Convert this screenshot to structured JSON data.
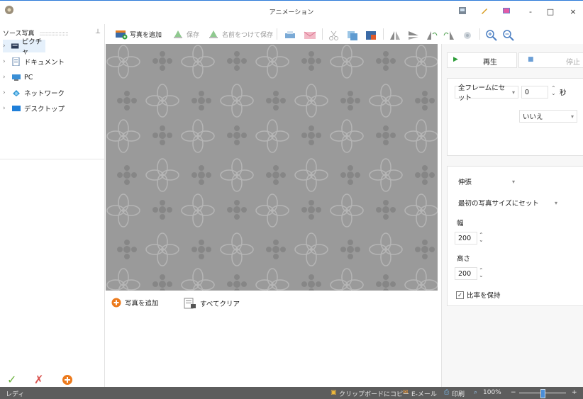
{
  "window": {
    "title": "アニメーション",
    "controls": [
      "-",
      "□",
      "×"
    ]
  },
  "left_panel": {
    "header": "ソース写真",
    "pin_glyph": "ꟷ",
    "tree": [
      {
        "label": "ピクチャ",
        "icon": "pictures-folder-icon"
      },
      {
        "label": "ドキュメント",
        "icon": "documents-folder-icon"
      },
      {
        "label": "PC",
        "icon": "computer-icon"
      },
      {
        "label": "ネットワーク",
        "icon": "network-icon"
      },
      {
        "label": "デスクトップ",
        "icon": "desktop-icon"
      }
    ],
    "bottom_icons": [
      "check-icon",
      "cross-icon",
      "add-circle-icon"
    ]
  },
  "toolbar": {
    "add_photo": "写真を追加",
    "save": "保存",
    "save_as": "名前をつけて保存"
  },
  "thumb_bar": {
    "add_photo": "写真を追加",
    "clear_all": "すべてクリア"
  },
  "right_panel": {
    "play": "再生",
    "stop": "停止",
    "frame_mode": "全フレームにセット",
    "seconds_value": "0",
    "seconds_unit": "秒",
    "loop": "いいえ",
    "resize_mode": "伸張",
    "size_mode": "最初の写真サイズにセット",
    "width_label": "幅",
    "width_value": "200",
    "height_label": "高さ",
    "height_value": "200",
    "keep_ratio": "比率を保持"
  },
  "status": {
    "ready": "レディ",
    "copy_clipboard": "クリップボードにコピー",
    "email": "E-メール",
    "print": "印刷",
    "zoom": "100%",
    "zoom_minus": "−",
    "zoom_plus": "+"
  },
  "colors": {
    "accent": "#2b79d8",
    "canvas_bg": "#9a9a9a",
    "statusbar": "#5d5d5d",
    "play_green": "#2e9e3a",
    "orange": "#ec7a1c"
  }
}
